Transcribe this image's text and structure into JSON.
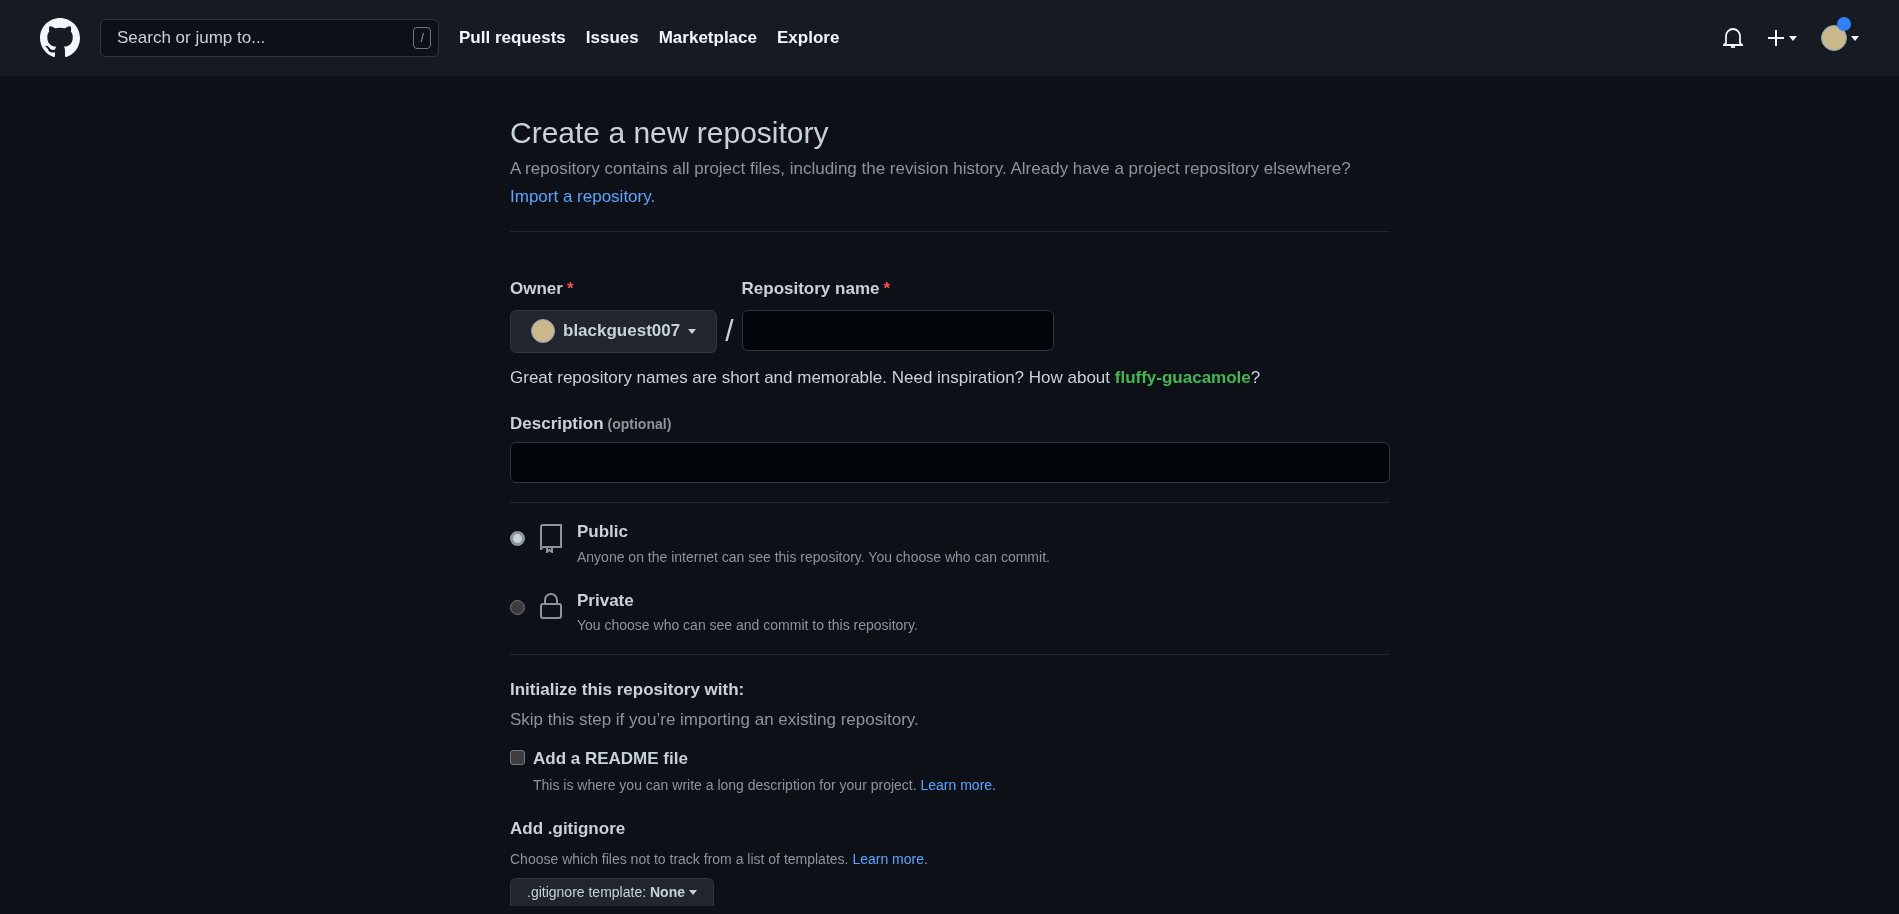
{
  "header": {
    "search_placeholder": "Search or jump to...",
    "search_key": "/",
    "nav": [
      "Pull requests",
      "Issues",
      "Marketplace",
      "Explore"
    ],
    "avatar_notification": true
  },
  "page": {
    "title": "Create a new repository",
    "subtitle": "A repository contains all project files, including the revision history. Already have a project repository elsewhere?",
    "import_link": "Import a repository."
  },
  "owner": {
    "label": "Owner",
    "required_mark": "*",
    "value": "blackguest007"
  },
  "separator": "/",
  "repo_name": {
    "label": "Repository name",
    "required_mark": "*"
  },
  "name_hint": "Great repository names are short and memorable. Need inspiration? How about **fluffy-guacamole**?",
  "description": {
    "label": "Description",
    "optional": "(optional)"
  },
  "visibility": [
    {
      "kind": "book",
      "label": "Public",
      "description": "Anyone on the internet can see this repository. You choose who can commit.",
      "selected": true
    },
    {
      "kind": "lock",
      "label": "Private",
      "description": "You choose who can see and commit to this repository.",
      "selected": false
    }
  ],
  "initialize": {
    "title": "Initialize this repository with:",
    "subtitle": "Skip this step if you’re importing an existing repository."
  },
  "readme": {
    "label": "Add a README file",
    "description": "This is where you can write a long description for your project.",
    "link": "Learn more.",
    "checked": false
  },
  "gitignore": {
    "title": "Add .gitignore",
    "description": "Choose which files not to track from a list of templates.",
    "link": "Learn more.",
    "button": ".gitignore template: **None**"
  }
}
